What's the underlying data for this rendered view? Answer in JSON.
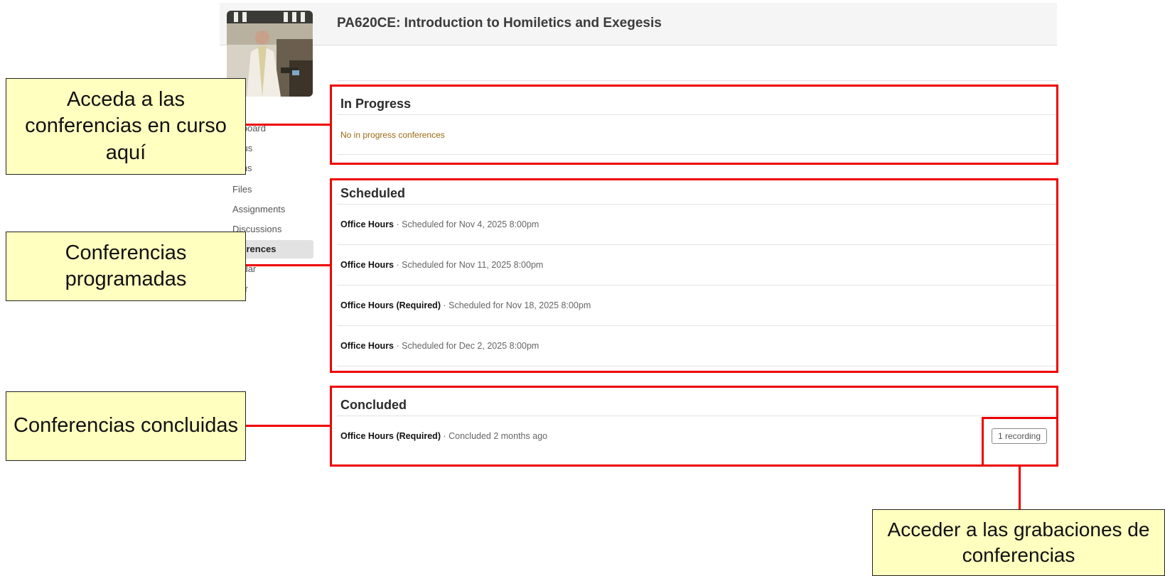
{
  "header": {
    "course_title": "PA620CE: Introduction to Homiletics and Exegesis"
  },
  "nav": {
    "items": [
      "shboard",
      "abus",
      "sons",
      "Files",
      "Assignments",
      "Discussions",
      "nferences",
      "endar",
      "ster"
    ],
    "active": "nferences"
  },
  "sections": {
    "in_progress": {
      "title": "In Progress",
      "empty_message": "No in progress conferences"
    },
    "scheduled": {
      "title": "Scheduled",
      "rows": [
        {
          "name": "Office Hours",
          "detail": " · Scheduled for Nov 4, 2025 8:00pm"
        },
        {
          "name": "Office Hours",
          "detail": " · Scheduled for Nov 11, 2025 8:00pm"
        },
        {
          "name": "Office Hours (Required)",
          "detail": " · Scheduled for Nov 18, 2025 8:00pm"
        },
        {
          "name": "Office Hours",
          "detail": " · Scheduled for Dec 2, 2025 8:00pm"
        }
      ]
    },
    "concluded": {
      "title": "Concluded",
      "rows": [
        {
          "name": "Office Hours (Required)",
          "detail": " · Concluded 2 months ago",
          "recording_label": "1 recording"
        }
      ]
    }
  },
  "callouts": {
    "in_progress": "Acceda a las conferencias en curso aquí",
    "scheduled": "Conferencias programadas",
    "concluded": "Conferencias concluidas",
    "recordings": "Acceder a las grabaciones de conferencias"
  },
  "colors": {
    "highlight": "#ee0000",
    "callout_bg": "#ffffbf",
    "empty_text": "#9a6a12"
  }
}
